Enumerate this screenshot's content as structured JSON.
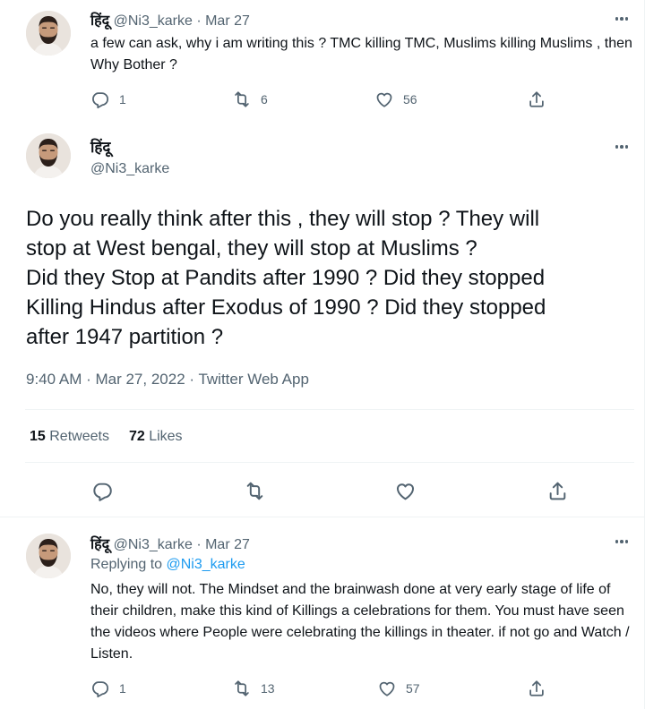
{
  "tweets": [
    {
      "display_name": "हिंदू",
      "handle": "@Ni3_karke",
      "date": "· Mar 27",
      "text": "a few can ask, why i am writing this ? TMC killing TMC, Muslims killing Muslims , then Why Bother ?",
      "replies": "1",
      "retweets": "6",
      "likes": "56"
    },
    {
      "display_name": "हिंदू",
      "handle": "@Ni3_karke",
      "date": "· Mar 27",
      "replying_prefix": "Replying to",
      "replying_handle": "@Ni3_karke",
      "text": "No, they will not. The Mindset and the brainwash done at very early stage of life of their children, make this kind of Killings a celebrations for them. You must have seen the videos where People were celebrating the killings in theater. if not go and Watch / Listen.",
      "replies": "1",
      "retweets": "13",
      "likes": "57"
    }
  ],
  "main_tweet": {
    "display_name": "हिंदू",
    "handle": "@Ni3_karke",
    "text_lines": [
      "Do you really think after this , they will stop ? They will",
      "stop at West bengal, they will stop at Muslims ?",
      "Did they Stop at Pandits after 1990 ? Did they stopped",
      "Killing Hindus after Exodus of 1990 ? Did they stopped",
      "after 1947 partition ?"
    ],
    "meta": "9:40 AM · Mar 27, 2022 · Twitter Web App",
    "retweet_count": "15",
    "retweet_label": "Retweets",
    "like_count": "72",
    "like_label": "Likes"
  },
  "icons": [
    "more-icon",
    "reply-icon",
    "retweet-icon",
    "like-icon",
    "share-icon"
  ],
  "colors": {
    "text": "#0f1419",
    "muted": "#536471",
    "link": "#1d9bf0",
    "divider": "#eff3f4"
  }
}
